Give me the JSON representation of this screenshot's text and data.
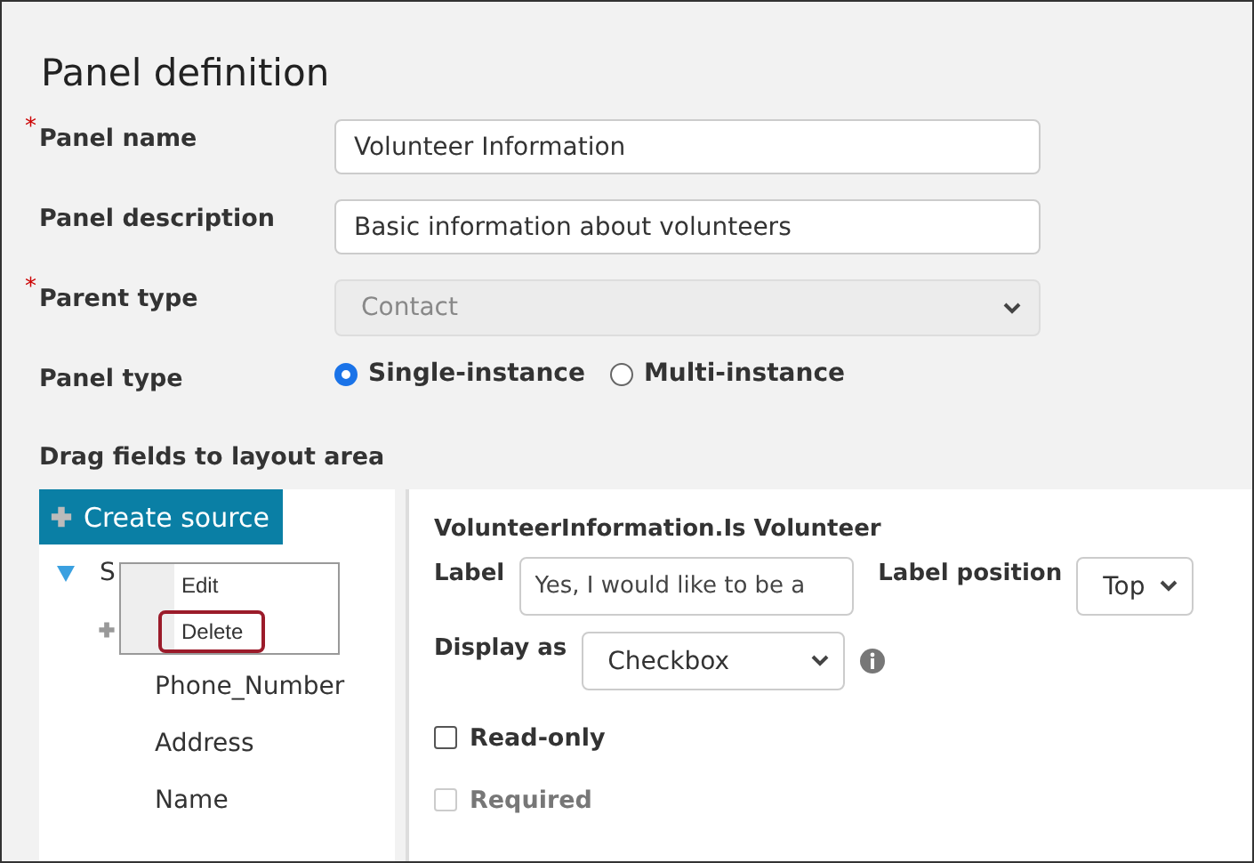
{
  "title": "Panel definition",
  "required_symbol": "*",
  "fields": [
    {
      "kind": "text",
      "label": "Panel name",
      "required": true,
      "value": "Volunteer Information"
    },
    {
      "kind": "text",
      "label": "Panel description",
      "required": false,
      "value": "Basic information about volunteers"
    },
    {
      "kind": "select",
      "label": "Parent type",
      "required": true,
      "value": "Contact",
      "disabled": true
    },
    {
      "kind": "radio",
      "label": "Panel type",
      "required": false,
      "options": [
        {
          "label": "Single-instance",
          "selected": true
        },
        {
          "label": "Multi-instance",
          "selected": false
        }
      ]
    }
  ],
  "drag_heading": "Drag fields to layout area",
  "source_panel": {
    "create_button": "Create source",
    "tree": [
      {
        "label": "S",
        "expanded": true,
        "children": [
          {
            "label": "Phone_Number"
          },
          {
            "label": "Address"
          },
          {
            "label": "Name"
          }
        ]
      }
    ]
  },
  "context_menu": {
    "items": [
      {
        "label": "Edit",
        "selected": false
      },
      {
        "label": "Delete",
        "selected": true
      }
    ]
  },
  "properties": {
    "heading": "VolunteerInformation.Is Volunteer",
    "label_label": "Label",
    "label_value": "Yes, I would like to be a",
    "position_label": "Label position",
    "position_value": "Top",
    "display_label": "Display as",
    "display_value": "Checkbox",
    "checks": [
      {
        "label": "Read-only",
        "checked": false,
        "disabled": false
      },
      {
        "label": "Required",
        "checked": false,
        "disabled": true
      }
    ]
  }
}
